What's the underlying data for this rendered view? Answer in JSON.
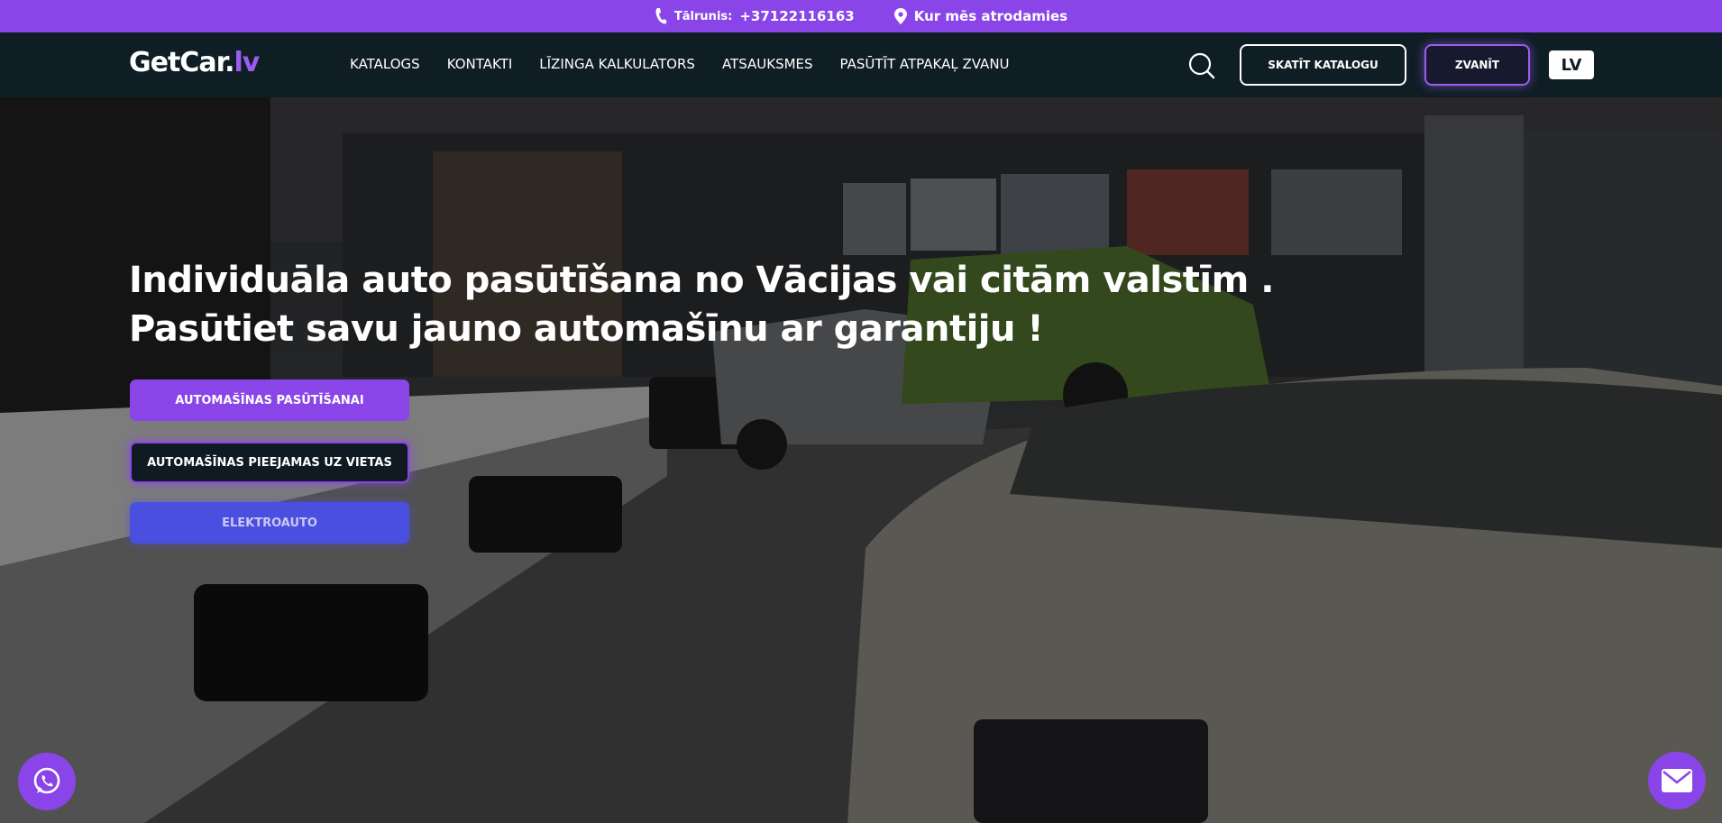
{
  "colors": {
    "accent": "#8a45e8",
    "nav_bg": "#0f1d24",
    "electro": "#4b4fe0"
  },
  "topbar": {
    "phone_label": "Tālrunis:",
    "phone_number": "+37122116163",
    "location_text": "Kur mēs atrodamies",
    "phone_icon": "phone-icon",
    "location_icon": "map-pin-icon"
  },
  "header": {
    "logo_main": "GetCar.",
    "logo_suffix": "lv",
    "nav": [
      {
        "label": "KATALOGS"
      },
      {
        "label": "KONTAKTI"
      },
      {
        "label": "LĪZINGA KALKULATORS"
      },
      {
        "label": "ATSAUKSMES"
      },
      {
        "label": "PASŪTĪT ATPAKAĻ ZVANU"
      }
    ],
    "search_icon": "search-icon",
    "catalog_button": "SKATĪT KATALOGU",
    "call_button": "ZVANĪT",
    "language": "LV"
  },
  "hero": {
    "title_line1": "Individuāla auto pasūtīšana no Vācijas vai citām valstīm .",
    "title_line2": "Pasūtiet savu jauno automašīnu ar garantiju !",
    "buttons": [
      {
        "label": "AUTOMAŠĪNAS PASŪTĪŠANAI"
      },
      {
        "label": "AUTOMAŠĪNAS PIEEJAMAS UZ VIETAS"
      },
      {
        "label": "ELEKTROAUTO"
      }
    ]
  },
  "floating": {
    "whatsapp_icon": "whatsapp-icon",
    "mail_icon": "envelope-icon"
  }
}
